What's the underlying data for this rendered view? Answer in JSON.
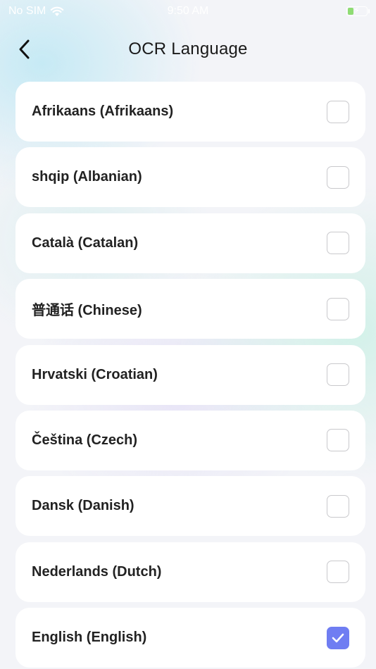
{
  "status_bar": {
    "carrier": "No SIM",
    "time": "9:50 AM"
  },
  "header": {
    "title": "OCR Language",
    "back_icon": "chevron-left-icon"
  },
  "languages": [
    {
      "label": "Afrikaans (Afrikaans)",
      "checked": false
    },
    {
      "label": "shqip (Albanian)",
      "checked": false
    },
    {
      "label": "Català (Catalan)",
      "checked": false
    },
    {
      "label": "普通话 (Chinese)",
      "checked": false
    },
    {
      "label": "Hrvatski (Croatian)",
      "checked": false
    },
    {
      "label": "Čeština (Czech)",
      "checked": false
    },
    {
      "label": "Dansk (Danish)",
      "checked": false
    },
    {
      "label": "Nederlands (Dutch)",
      "checked": false
    },
    {
      "label": "English (English)",
      "checked": true
    }
  ],
  "colors": {
    "accent": "#6f7df2",
    "card": "#ffffff",
    "text": "#222222"
  }
}
